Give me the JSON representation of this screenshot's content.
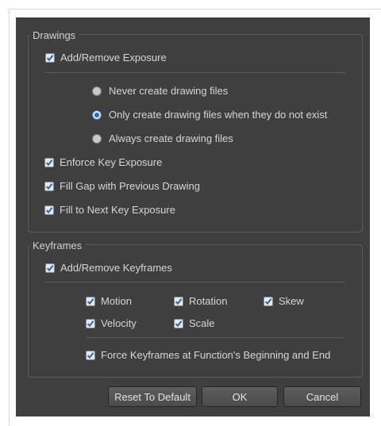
{
  "drawings": {
    "legend": "Drawings",
    "add_remove_exposure": "Add/Remove Exposure",
    "radio_options": [
      "Never create drawing files",
      "Only create drawing files when they do not exist",
      "Always create drawing files"
    ],
    "selected_radio": 1,
    "enforce_key_exposure": "Enforce Key Exposure",
    "fill_gap": "Fill Gap with Previous Drawing",
    "fill_next_key": "Fill to Next Key Exposure"
  },
  "keyframes": {
    "legend": "Keyframes",
    "add_remove_keyframes": "Add/Remove Keyframes",
    "motion": "Motion",
    "rotation": "Rotation",
    "skew": "Skew",
    "velocity": "Velocity",
    "scale": "Scale",
    "force_keyframes": "Force Keyframes at Function's Beginning and End"
  },
  "buttons": {
    "reset": "Reset To Default",
    "ok": "OK",
    "cancel": "Cancel"
  },
  "colors": {
    "dialog_bg": "#3f3f3f",
    "check_accent": "#2468b8"
  },
  "icons": {
    "checkbox": "checkmark-icon",
    "radio": "radio-dot-icon"
  }
}
